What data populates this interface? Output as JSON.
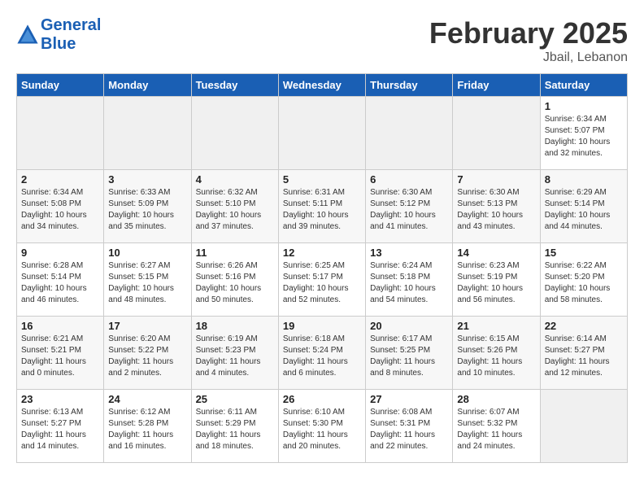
{
  "header": {
    "logo_line1": "General",
    "logo_line2": "Blue",
    "month": "February 2025",
    "location": "Jbail, Lebanon"
  },
  "days_of_week": [
    "Sunday",
    "Monday",
    "Tuesday",
    "Wednesday",
    "Thursday",
    "Friday",
    "Saturday"
  ],
  "weeks": [
    [
      {
        "day": "",
        "empty": true
      },
      {
        "day": "",
        "empty": true
      },
      {
        "day": "",
        "empty": true
      },
      {
        "day": "",
        "empty": true
      },
      {
        "day": "",
        "empty": true
      },
      {
        "day": "",
        "empty": true
      },
      {
        "day": "1",
        "sunrise": "Sunrise: 6:34 AM",
        "sunset": "Sunset: 5:07 PM",
        "daylight": "Daylight: 10 hours and 32 minutes."
      }
    ],
    [
      {
        "day": "2",
        "sunrise": "Sunrise: 6:34 AM",
        "sunset": "Sunset: 5:08 PM",
        "daylight": "Daylight: 10 hours and 34 minutes."
      },
      {
        "day": "3",
        "sunrise": "Sunrise: 6:33 AM",
        "sunset": "Sunset: 5:09 PM",
        "daylight": "Daylight: 10 hours and 35 minutes."
      },
      {
        "day": "4",
        "sunrise": "Sunrise: 6:32 AM",
        "sunset": "Sunset: 5:10 PM",
        "daylight": "Daylight: 10 hours and 37 minutes."
      },
      {
        "day": "5",
        "sunrise": "Sunrise: 6:31 AM",
        "sunset": "Sunset: 5:11 PM",
        "daylight": "Daylight: 10 hours and 39 minutes."
      },
      {
        "day": "6",
        "sunrise": "Sunrise: 6:30 AM",
        "sunset": "Sunset: 5:12 PM",
        "daylight": "Daylight: 10 hours and 41 minutes."
      },
      {
        "day": "7",
        "sunrise": "Sunrise: 6:30 AM",
        "sunset": "Sunset: 5:13 PM",
        "daylight": "Daylight: 10 hours and 43 minutes."
      },
      {
        "day": "8",
        "sunrise": "Sunrise: 6:29 AM",
        "sunset": "Sunset: 5:14 PM",
        "daylight": "Daylight: 10 hours and 44 minutes."
      }
    ],
    [
      {
        "day": "9",
        "sunrise": "Sunrise: 6:28 AM",
        "sunset": "Sunset: 5:14 PM",
        "daylight": "Daylight: 10 hours and 46 minutes."
      },
      {
        "day": "10",
        "sunrise": "Sunrise: 6:27 AM",
        "sunset": "Sunset: 5:15 PM",
        "daylight": "Daylight: 10 hours and 48 minutes."
      },
      {
        "day": "11",
        "sunrise": "Sunrise: 6:26 AM",
        "sunset": "Sunset: 5:16 PM",
        "daylight": "Daylight: 10 hours and 50 minutes."
      },
      {
        "day": "12",
        "sunrise": "Sunrise: 6:25 AM",
        "sunset": "Sunset: 5:17 PM",
        "daylight": "Daylight: 10 hours and 52 minutes."
      },
      {
        "day": "13",
        "sunrise": "Sunrise: 6:24 AM",
        "sunset": "Sunset: 5:18 PM",
        "daylight": "Daylight: 10 hours and 54 minutes."
      },
      {
        "day": "14",
        "sunrise": "Sunrise: 6:23 AM",
        "sunset": "Sunset: 5:19 PM",
        "daylight": "Daylight: 10 hours and 56 minutes."
      },
      {
        "day": "15",
        "sunrise": "Sunrise: 6:22 AM",
        "sunset": "Sunset: 5:20 PM",
        "daylight": "Daylight: 10 hours and 58 minutes."
      }
    ],
    [
      {
        "day": "16",
        "sunrise": "Sunrise: 6:21 AM",
        "sunset": "Sunset: 5:21 PM",
        "daylight": "Daylight: 11 hours and 0 minutes."
      },
      {
        "day": "17",
        "sunrise": "Sunrise: 6:20 AM",
        "sunset": "Sunset: 5:22 PM",
        "daylight": "Daylight: 11 hours and 2 minutes."
      },
      {
        "day": "18",
        "sunrise": "Sunrise: 6:19 AM",
        "sunset": "Sunset: 5:23 PM",
        "daylight": "Daylight: 11 hours and 4 minutes."
      },
      {
        "day": "19",
        "sunrise": "Sunrise: 6:18 AM",
        "sunset": "Sunset: 5:24 PM",
        "daylight": "Daylight: 11 hours and 6 minutes."
      },
      {
        "day": "20",
        "sunrise": "Sunrise: 6:17 AM",
        "sunset": "Sunset: 5:25 PM",
        "daylight": "Daylight: 11 hours and 8 minutes."
      },
      {
        "day": "21",
        "sunrise": "Sunrise: 6:15 AM",
        "sunset": "Sunset: 5:26 PM",
        "daylight": "Daylight: 11 hours and 10 minutes."
      },
      {
        "day": "22",
        "sunrise": "Sunrise: 6:14 AM",
        "sunset": "Sunset: 5:27 PM",
        "daylight": "Daylight: 11 hours and 12 minutes."
      }
    ],
    [
      {
        "day": "23",
        "sunrise": "Sunrise: 6:13 AM",
        "sunset": "Sunset: 5:27 PM",
        "daylight": "Daylight: 11 hours and 14 minutes."
      },
      {
        "day": "24",
        "sunrise": "Sunrise: 6:12 AM",
        "sunset": "Sunset: 5:28 PM",
        "daylight": "Daylight: 11 hours and 16 minutes."
      },
      {
        "day": "25",
        "sunrise": "Sunrise: 6:11 AM",
        "sunset": "Sunset: 5:29 PM",
        "daylight": "Daylight: 11 hours and 18 minutes."
      },
      {
        "day": "26",
        "sunrise": "Sunrise: 6:10 AM",
        "sunset": "Sunset: 5:30 PM",
        "daylight": "Daylight: 11 hours and 20 minutes."
      },
      {
        "day": "27",
        "sunrise": "Sunrise: 6:08 AM",
        "sunset": "Sunset: 5:31 PM",
        "daylight": "Daylight: 11 hours and 22 minutes."
      },
      {
        "day": "28",
        "sunrise": "Sunrise: 6:07 AM",
        "sunset": "Sunset: 5:32 PM",
        "daylight": "Daylight: 11 hours and 24 minutes."
      },
      {
        "day": "",
        "empty": true
      }
    ]
  ]
}
